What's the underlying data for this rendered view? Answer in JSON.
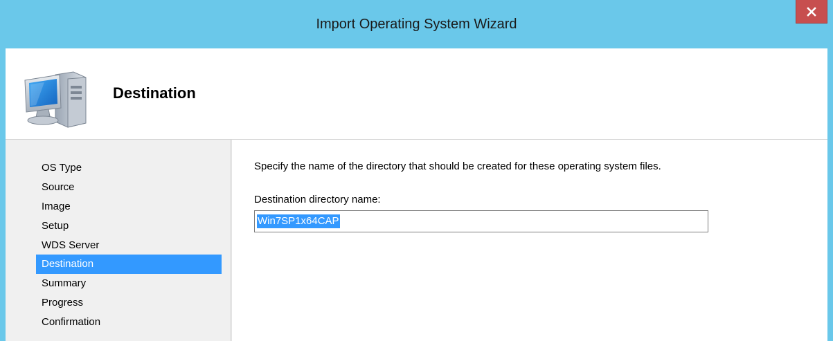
{
  "window": {
    "title": "Import Operating System Wizard",
    "close_glyph": "x",
    "accent_color": "#6ac8ea"
  },
  "header": {
    "title": "Destination",
    "icon": "computer-icon"
  },
  "nav": {
    "items": [
      {
        "label": "OS Type",
        "active": false
      },
      {
        "label": "Source",
        "active": false
      },
      {
        "label": "Image",
        "active": false
      },
      {
        "label": "Setup",
        "active": false
      },
      {
        "label": "WDS Server",
        "active": false
      },
      {
        "label": "Destination",
        "active": true
      },
      {
        "label": "Summary",
        "active": false
      },
      {
        "label": "Progress",
        "active": false
      },
      {
        "label": "Confirmation",
        "active": false
      }
    ],
    "selection_color": "#3399ff"
  },
  "content": {
    "instruction": "Specify the name of the directory that should be created for these operating system files.",
    "field_label": "Destination directory name:",
    "field_value": "Win7SP1x64CAP"
  }
}
